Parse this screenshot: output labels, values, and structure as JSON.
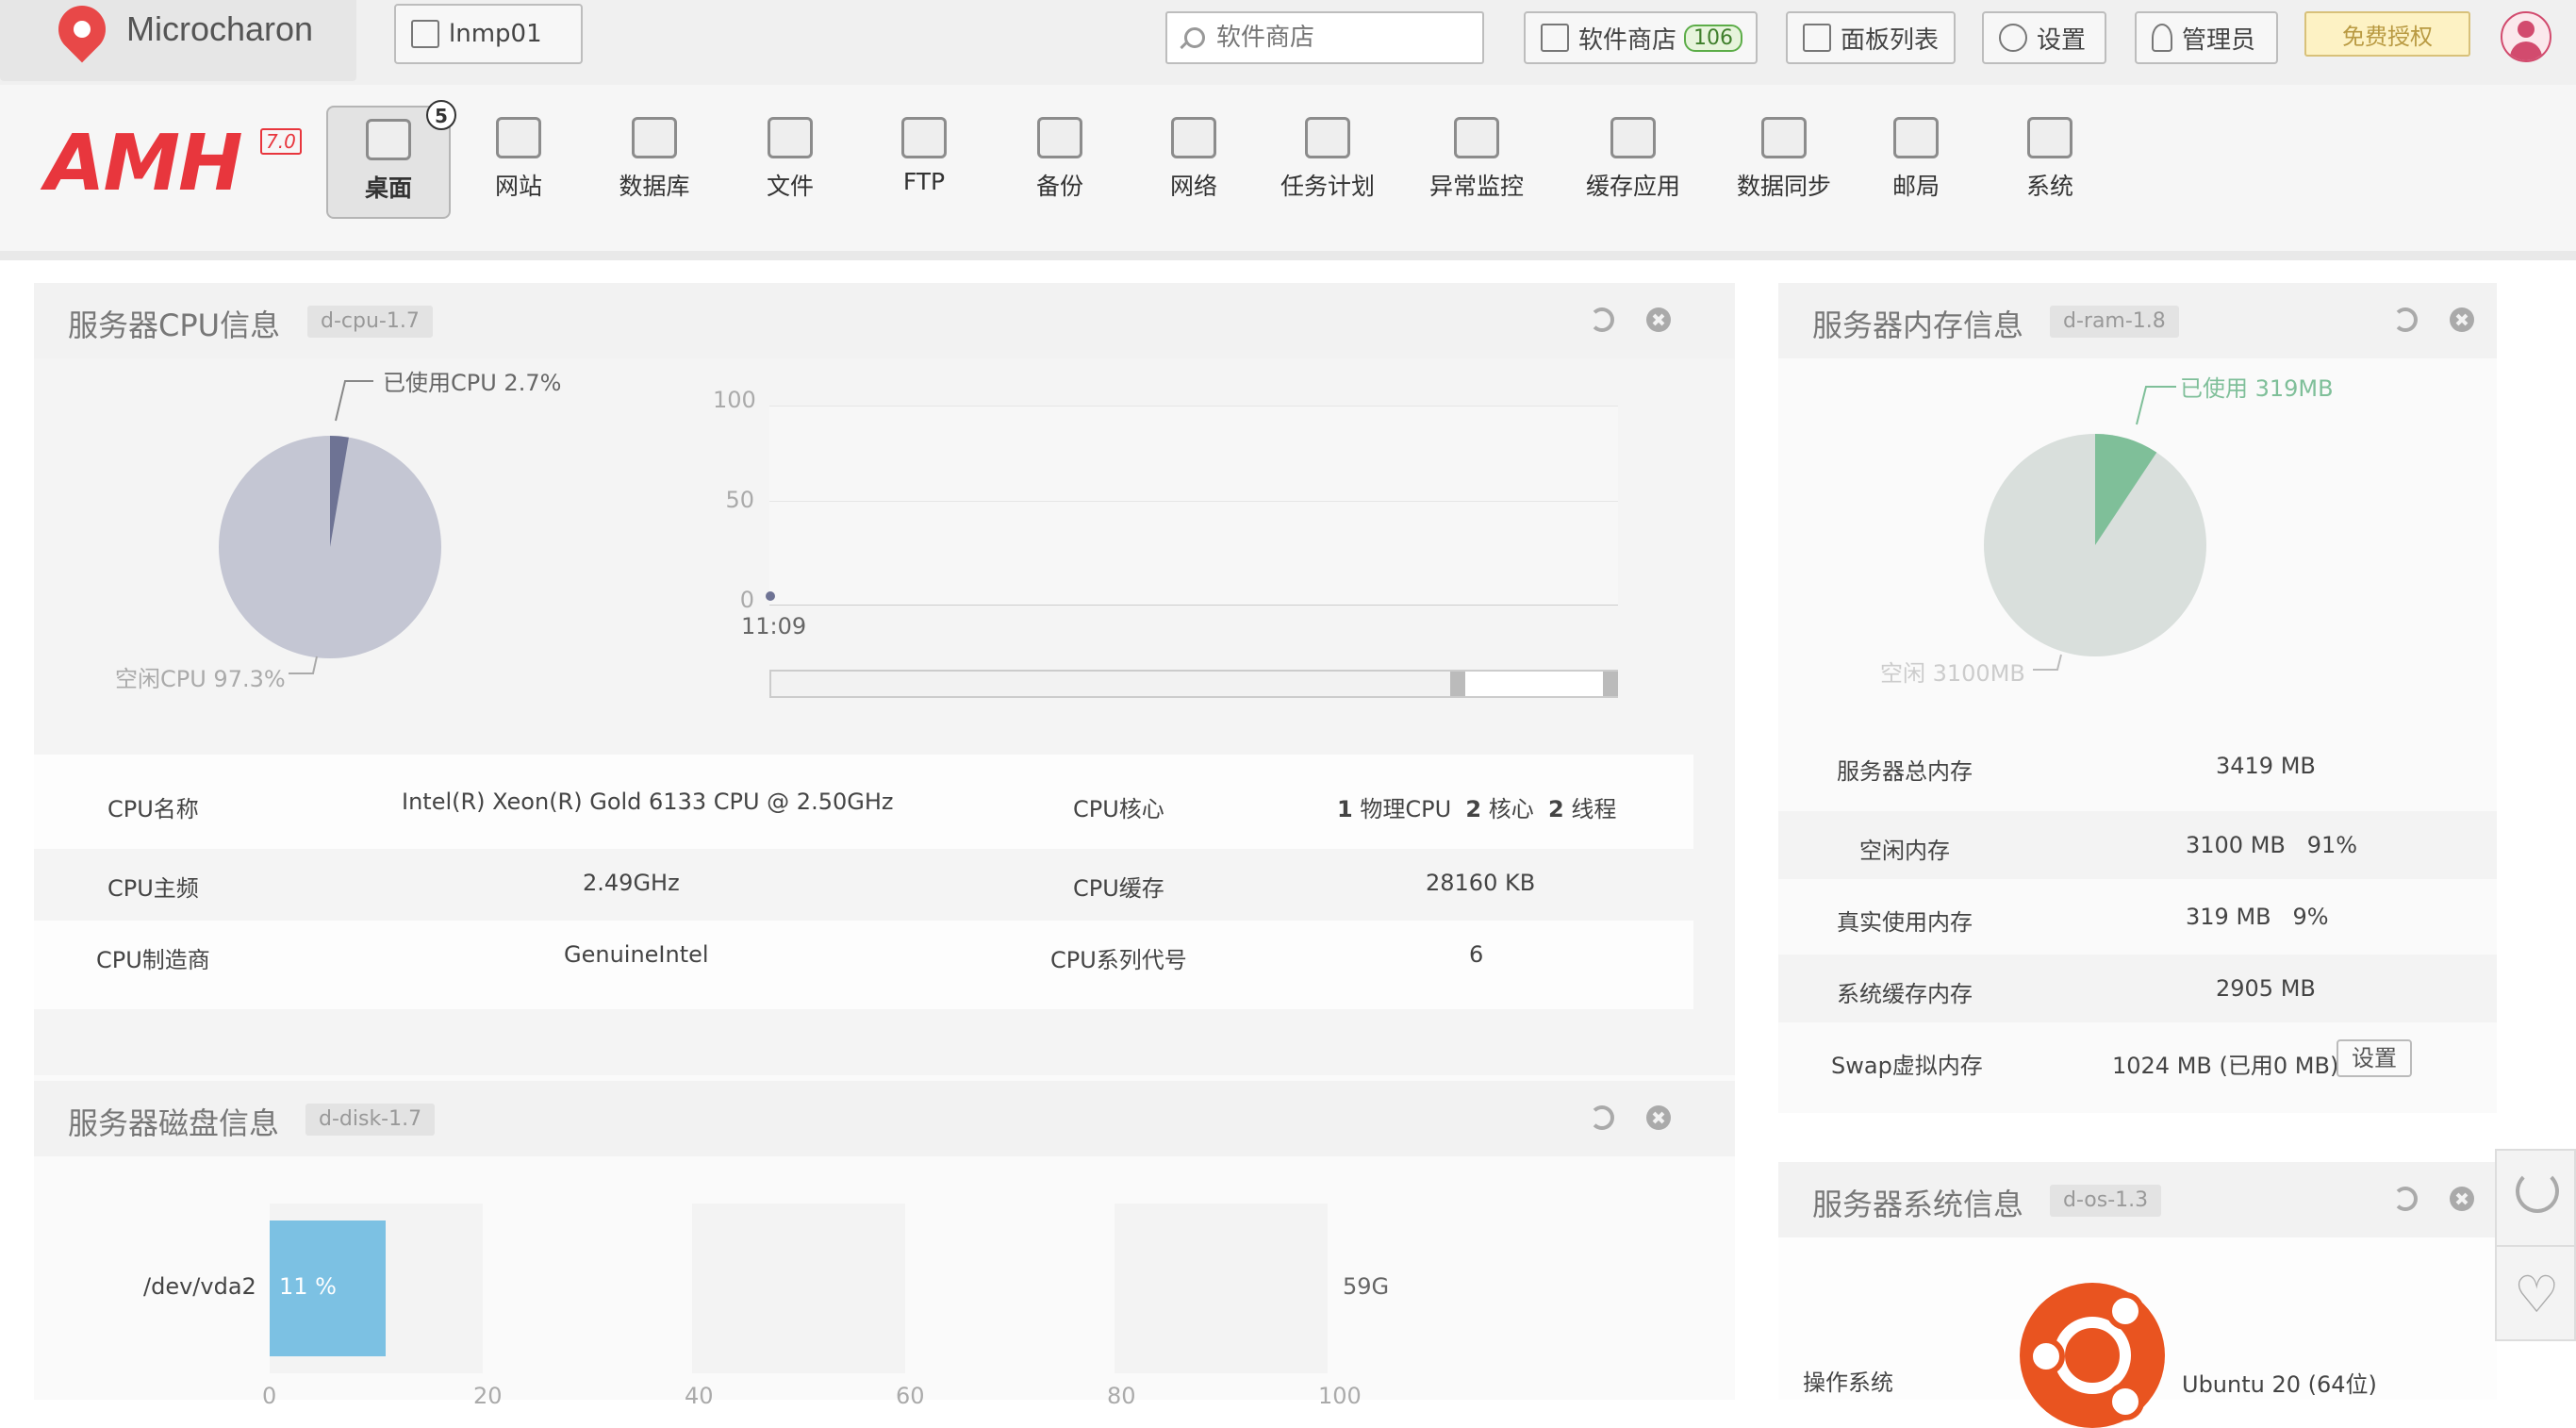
{
  "topbar": {
    "brand": "Microcharon",
    "server_tab": "lnmp01",
    "search_placeholder": "软件商店",
    "store_label": "软件商店",
    "store_count": "106",
    "panel_list_label": "面板列表",
    "settings_label": "设置",
    "admin_label": "管理员",
    "free_license_label": "免费授权"
  },
  "nav": {
    "logo": "AMH",
    "logo_version": "7.0",
    "items": [
      {
        "label": "桌面",
        "icon": "home-icon",
        "badge": "5"
      },
      {
        "label": "网站",
        "icon": "website-icon"
      },
      {
        "label": "数据库",
        "icon": "database-icon"
      },
      {
        "label": "文件",
        "icon": "folder-icon"
      },
      {
        "label": "FTP",
        "icon": "ftp-icon"
      },
      {
        "label": "备份",
        "icon": "clock-icon"
      },
      {
        "label": "网络",
        "icon": "globe-icon"
      },
      {
        "label": "任务计划",
        "icon": "schedule-icon"
      },
      {
        "label": "异常监控",
        "icon": "monitor-icon"
      },
      {
        "label": "缓存应用",
        "icon": "cache-icon"
      },
      {
        "label": "数据同步",
        "icon": "sync-icon"
      },
      {
        "label": "邮局",
        "icon": "mail-icon"
      },
      {
        "label": "系统",
        "icon": "system-icon"
      }
    ]
  },
  "cpu": {
    "title": "服务器CPU信息",
    "tag": "d-cpu-1.7",
    "used_label": "已使用CPU 2.7%",
    "idle_label": "空闲CPU 97.3%",
    "pie": {
      "used": 2.7,
      "idle": 97.3,
      "used_color": "#6e7394",
      "idle_color": "#c4c6d3"
    },
    "chart": {
      "y_ticks": [
        "100",
        "50",
        "0"
      ],
      "x_label": "11:09",
      "values": [
        0
      ]
    },
    "rows": [
      {
        "k1": "CPU名称",
        "v1": "Intel(R) Xeon(R) Gold 6133 CPU @ 2.50GHz",
        "k2": "CPU核心",
        "v2a": "1",
        "v2a_t": "物理CPU",
        "v2b": "2",
        "v2b_t": "核心",
        "v2c": "2",
        "v2c_t": "线程"
      },
      {
        "k1": "CPU主频",
        "v1": "2.49GHz",
        "k2": "CPU缓存",
        "v2": "28160 KB"
      },
      {
        "k1": "CPU制造商",
        "v1": "GenuineIntel",
        "k2": "CPU系列代号",
        "v2": "6"
      }
    ]
  },
  "ram": {
    "title": "服务器内存信息",
    "tag": "d-ram-1.8",
    "used_label": "已使用 319MB",
    "free_label": "空闲 3100MB",
    "pie": {
      "used": 319,
      "free": 3100,
      "used_color": "#7fbf99",
      "free_color": "#d9dfdc"
    },
    "rows": [
      {
        "k": "服务器总内存",
        "v": "3419 MB"
      },
      {
        "k": "空闲内存",
        "v": "3100 MB   91%"
      },
      {
        "k": "真实使用内存",
        "v": "319 MB   9%"
      },
      {
        "k": "系统缓存内存",
        "v": "2905 MB"
      },
      {
        "k": "Swap虚拟内存",
        "v": "1024 MB (已用0 MB)",
        "button": "设置"
      }
    ]
  },
  "disk": {
    "title": "服务器磁盘信息",
    "tag": "d-disk-1.7",
    "device": "/dev/vda2",
    "percent_label": "11 %",
    "percent": 11,
    "size": "59G",
    "x_ticks": [
      "0",
      "20",
      "40",
      "60",
      "80",
      "100"
    ],
    "bar_color": "#7cc1e3"
  },
  "os": {
    "title": "服务器系统信息",
    "tag": "d-os-1.3",
    "os_label": "操作系统",
    "os_value": "Ubuntu 20 (64位)"
  }
}
